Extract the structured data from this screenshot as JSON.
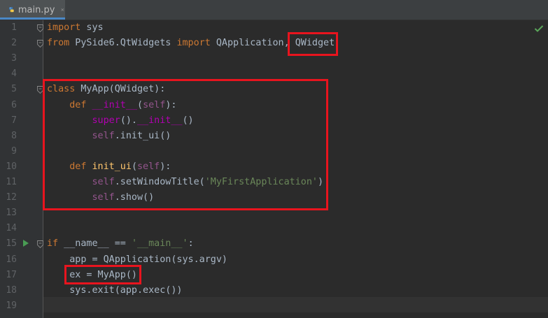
{
  "tab": {
    "filename": "main.py",
    "file_icon": "python-file-icon",
    "close_icon": "close-icon"
  },
  "status": {
    "inspection_icon": "checkmark-icon",
    "run_icon": "run-icon"
  },
  "colors": {
    "keyword": "#cc7832",
    "function": "#ffc66d",
    "self": "#94558d",
    "dunder": "#b200b2",
    "string": "#6a8759",
    "text": "#a9b7c6",
    "highlight_box": "#e8141e"
  },
  "lines": [
    {
      "n": "1",
      "tokens": [
        {
          "t": "import",
          "c": "kw"
        },
        {
          "t": " sys",
          "c": "plain"
        }
      ]
    },
    {
      "n": "2",
      "tokens": [
        {
          "t": "from",
          "c": "kw"
        },
        {
          "t": " PySide6.QtWidgets ",
          "c": "plain"
        },
        {
          "t": "import",
          "c": "kw"
        },
        {
          "t": " QApplication, QWidget",
          "c": "plain"
        }
      ]
    },
    {
      "n": "3",
      "tokens": []
    },
    {
      "n": "4",
      "tokens": []
    },
    {
      "n": "5",
      "tokens": [
        {
          "t": "class",
          "c": "kw"
        },
        {
          "t": " MyApp(QWidget):",
          "c": "plain"
        }
      ]
    },
    {
      "n": "6",
      "tokens": [
        {
          "t": "    ",
          "c": "plain"
        },
        {
          "t": "def",
          "c": "kw"
        },
        {
          "t": " ",
          "c": "plain"
        },
        {
          "t": "__init__",
          "c": "dunder"
        },
        {
          "t": "(",
          "c": "plain"
        },
        {
          "t": "self",
          "c": "self"
        },
        {
          "t": "):",
          "c": "plain"
        }
      ]
    },
    {
      "n": "7",
      "tokens": [
        {
          "t": "        ",
          "c": "plain"
        },
        {
          "t": "super",
          "c": "dunder"
        },
        {
          "t": "().",
          "c": "plain"
        },
        {
          "t": "__init__",
          "c": "dunder"
        },
        {
          "t": "()",
          "c": "plain"
        }
      ]
    },
    {
      "n": "8",
      "tokens": [
        {
          "t": "        ",
          "c": "plain"
        },
        {
          "t": "self",
          "c": "self"
        },
        {
          "t": ".init_ui()",
          "c": "plain"
        }
      ]
    },
    {
      "n": "9",
      "tokens": []
    },
    {
      "n": "10",
      "tokens": [
        {
          "t": "    ",
          "c": "plain"
        },
        {
          "t": "def",
          "c": "kw"
        },
        {
          "t": " ",
          "c": "plain"
        },
        {
          "t": "init_ui",
          "c": "fn"
        },
        {
          "t": "(",
          "c": "plain"
        },
        {
          "t": "self",
          "c": "self"
        },
        {
          "t": "):",
          "c": "plain"
        }
      ]
    },
    {
      "n": "11",
      "tokens": [
        {
          "t": "        ",
          "c": "plain"
        },
        {
          "t": "self",
          "c": "self"
        },
        {
          "t": ".setWindowTitle(",
          "c": "plain"
        },
        {
          "t": "'MyFirstApplication'",
          "c": "str"
        },
        {
          "t": ")",
          "c": "plain"
        }
      ]
    },
    {
      "n": "12",
      "tokens": [
        {
          "t": "        ",
          "c": "plain"
        },
        {
          "t": "self",
          "c": "self"
        },
        {
          "t": ".show()",
          "c": "plain"
        }
      ]
    },
    {
      "n": "13",
      "tokens": []
    },
    {
      "n": "14",
      "tokens": []
    },
    {
      "n": "15",
      "tokens": [
        {
          "t": "if",
          "c": "kw"
        },
        {
          "t": " __name__ == ",
          "c": "plain"
        },
        {
          "t": "'__main__'",
          "c": "str"
        },
        {
          "t": ":",
          "c": "plain"
        }
      ]
    },
    {
      "n": "16",
      "tokens": [
        {
          "t": "    app = QApplication(sys.argv)",
          "c": "plain"
        }
      ]
    },
    {
      "n": "17",
      "tokens": [
        {
          "t": "    ex = MyApp()",
          "c": "plain"
        }
      ]
    },
    {
      "n": "18",
      "tokens": [
        {
          "t": "    sys.exit(app.exec())",
          "c": "plain"
        }
      ]
    },
    {
      "n": "19",
      "tokens": []
    }
  ]
}
